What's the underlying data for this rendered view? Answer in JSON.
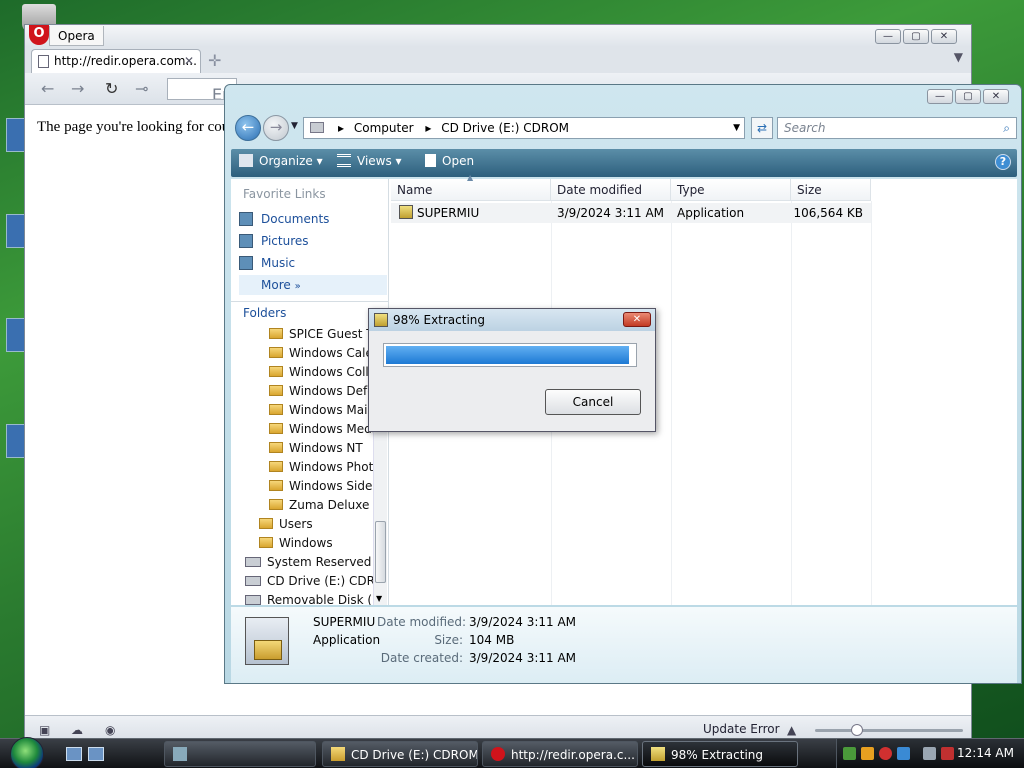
{
  "opera": {
    "menu_label": "Opera",
    "tab_title": "http://redir.opera.com...",
    "tab_close": "✕",
    "new_tab": "✛",
    "address_partial": "En",
    "page_message": "The page you're looking for cou",
    "status_update": "Update Error"
  },
  "explorer": {
    "breadcrumb": [
      "Computer",
      "CD Drive (E:) CDROM"
    ],
    "breadcrumb_sep": "▸",
    "search_placeholder": "Search",
    "toolbar": {
      "organize": "Organize",
      "views": "Views",
      "open": "Open"
    },
    "favorites_header": "Favorite Links",
    "favorites": [
      "Documents",
      "Pictures",
      "Music",
      "More"
    ],
    "folders_header": "Folders",
    "tree": [
      {
        "label": "SPICE Guest Tools",
        "indent": 2
      },
      {
        "label": "Windows Calendar",
        "indent": 2
      },
      {
        "label": "Windows Collaboration",
        "indent": 2
      },
      {
        "label": "Windows Defender",
        "indent": 2
      },
      {
        "label": "Windows Mail",
        "indent": 2
      },
      {
        "label": "Windows Media Player",
        "indent": 2
      },
      {
        "label": "Windows NT",
        "indent": 2
      },
      {
        "label": "Windows Photo Gallery",
        "indent": 2
      },
      {
        "label": "Windows Sidebar",
        "indent": 2
      },
      {
        "label": "Zuma Deluxe (",
        "indent": 2
      },
      {
        "label": "Users",
        "indent": 1
      },
      {
        "label": "Windows",
        "indent": 1
      },
      {
        "label": "System Reserved (C:)",
        "indent": 0
      },
      {
        "label": "CD Drive (E:) CDROM",
        "indent": 0
      },
      {
        "label": "Removable Disk (F:)",
        "indent": 0
      }
    ],
    "columns": [
      "Name",
      "Date modified",
      "Type",
      "Size"
    ],
    "files": [
      {
        "name": "SUPERMIU",
        "date": "3/9/2024 3:11 AM",
        "type": "Application",
        "size": "106,564 KB"
      }
    ],
    "details": {
      "name": "SUPERMIU",
      "type": "Application",
      "date_modified_label": "Date modified:",
      "date_modified": "3/9/2024 3:11 AM",
      "size_label": "Size:",
      "size": "104 MB",
      "date_created_label": "Date created:",
      "date_created": "3/9/2024 3:11 AM"
    }
  },
  "dialog": {
    "title": "98% Extracting",
    "progress": 0.98,
    "cancel_label": "Cancel",
    "close_glyph": "✕"
  },
  "taskbar": {
    "buttons": [
      "CD Drive (E:) CDROM",
      "http://redir.opera.c...",
      "98% Extracting"
    ],
    "clock": "12:14 AM"
  },
  "colors": {
    "accent": "#1d79d4",
    "command_bar": "#2d5f7d",
    "link": "#1c4f9a"
  },
  "icons": [
    "opera-logo-icon",
    "page-icon",
    "back-arrow-icon",
    "forward-arrow-icon",
    "reload-icon",
    "folder-icon",
    "drive-icon",
    "application-icon",
    "search-icon",
    "help-icon",
    "windows-orb-icon"
  ]
}
